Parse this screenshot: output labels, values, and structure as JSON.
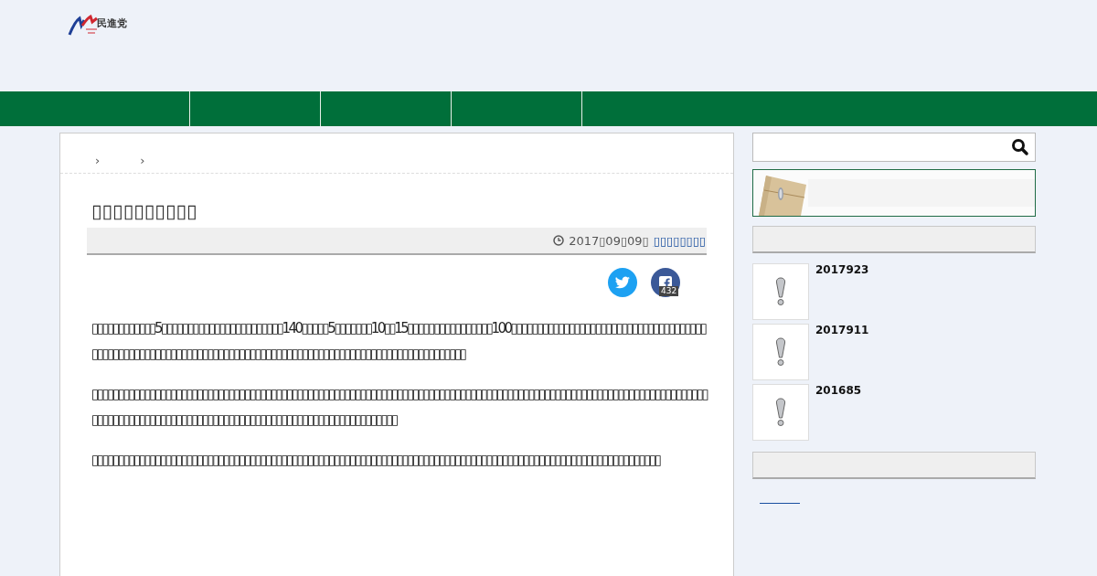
{
  "header": {
    "logo_text": "民進党"
  },
  "breadcrumb": [
    "›",
    "›"
  ],
  "article": {
    "title": "▯▯▯▯▯▯▯▯▯▯",
    "date": "2017▯09▯09▯",
    "category": "▯▯▯▯▯▯▯▯",
    "share": {
      "facebook_count": "432"
    },
    "paragraphs": [
      "▯▯▯▯▯▯▯▯▯▯▯▯5▯▯▯▯▯▯▯▯▯▯▯▯▯▯▯▯▯▯▯▯▯▯▯140▯▯▯▯▯5▯▯▯▯▯▯▯10▯▯15▯▯▯▯▯▯▯▯▯▯▯▯▯▯▯▯100▯▯▯▯▯▯▯▯▯▯▯▯▯▯▯▯▯▯▯▯▯▯▯▯▯▯▯▯▯▯▯▯▯▯▯▯▯▯▯▯▯▯▯▯▯▯▯▯▯▯▯▯▯▯▯▯▯▯▯▯▯▯▯▯▯▯▯▯▯▯▯▯▯▯▯▯▯▯▯▯▯▯▯▯▯▯▯▯▯▯▯▯▯▯▯▯▯▯▯▯▯▯▯▯▯▯▯▯",
      "▯▯▯▯▯▯▯▯▯▯▯▯▯▯▯▯▯▯▯▯▯▯▯▯▯▯▯▯▯▯▯▯▯▯▯▯▯▯▯▯▯▯▯▯▯▯▯▯▯▯▯▯▯▯▯▯▯▯▯▯▯▯▯▯▯▯▯▯▯▯▯▯▯▯▯▯▯▯▯▯▯▯▯▯▯▯▯▯▯▯▯▯▯▯▯▯▯▯▯▯▯▯▯▯▯▯▯▯▯▯▯▯▯▯▯▯▯▯▯▯▯▯▯▯▯▯▯▯▯▯▯▯▯▯▯▯▯▯▯▯▯▯▯▯▯▯▯▯▯▯▯▯▯▯▯▯▯▯▯▯▯▯▯▯▯▯▯▯▯▯▯▯▯▯▯",
      "▯▯▯▯▯▯▯▯▯▯▯▯▯▯▯▯▯▯▯▯▯▯▯▯▯▯▯▯▯▯▯▯▯▯▯▯▯▯▯▯▯▯▯▯▯▯▯▯▯▯▯▯▯▯▯▯▯▯▯▯▯▯▯▯▯▯▯▯▯▯▯▯▯▯▯▯▯▯▯▯▯▯▯▯▯▯▯▯▯▯▯▯▯▯▯▯▯▯▯▯▯▯▯▯▯▯▯▯"
    ]
  },
  "sidebar": {
    "posts": [
      {
        "title": "2017923"
      },
      {
        "title": "2017911"
      },
      {
        "title": "201685"
      }
    ]
  }
}
